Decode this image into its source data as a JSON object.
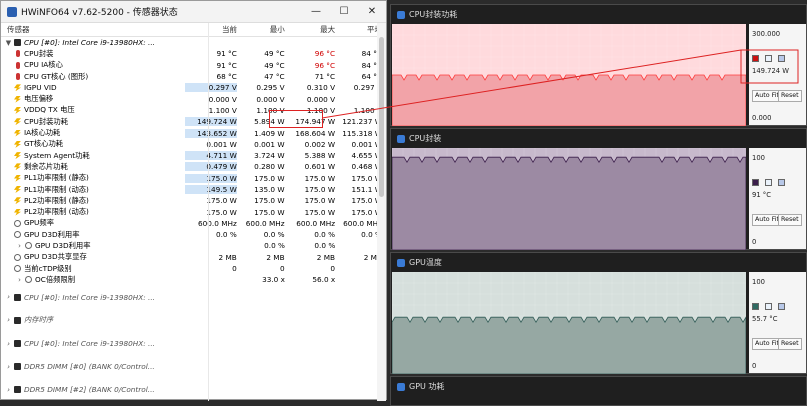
{
  "window": {
    "title": "HWiNFO64 v7.62-5200 - 传感器状态",
    "min": "—",
    "max": "☐",
    "close": "✕"
  },
  "header": {
    "sensor": "传感器",
    "current": "当前",
    "min": "最小",
    "max": "最大",
    "avg": "平均"
  },
  "rows": [
    {
      "tw": "▼",
      "icon": "chip",
      "label": "CPU [#0]: Intel Core i9-13980HX: ...",
      "italic": true,
      "c": [
        "",
        "",
        "",
        ""
      ]
    },
    {
      "tw": "",
      "icon": "therm",
      "label": "CPU封装",
      "c": [
        "91 °C",
        "49 °C",
        "96 °C",
        "84 °C"
      ],
      "maxred": true
    },
    {
      "tw": "",
      "icon": "therm",
      "label": "CPU IA核心",
      "c": [
        "91 °C",
        "49 °C",
        "96 °C",
        "84 °C"
      ],
      "maxred": true
    },
    {
      "tw": "",
      "icon": "therm",
      "label": "CPU GT核心 (图形)",
      "c": [
        "68 °C",
        "47 °C",
        "71 °C",
        "64 °C"
      ]
    },
    {
      "tw": "",
      "icon": "bolt",
      "label": "IGPU VID",
      "c": [
        "0.297 V",
        "0.295 V",
        "0.310 V",
        "0.297 V"
      ],
      "hl": true
    },
    {
      "tw": "",
      "icon": "bolt",
      "label": "电压偏移",
      "c": [
        "0.000 V",
        "0.000 V",
        "0.000 V",
        ""
      ]
    },
    {
      "tw": "",
      "icon": "bolt",
      "label": "VDDQ TX 电压",
      "c": [
        "1.100 V",
        "1.100 V",
        "1.100 V",
        "1.100 V"
      ]
    },
    {
      "tw": "",
      "icon": "bolt",
      "label": "CPU封装功耗",
      "c": [
        "149.724 W",
        "5.894 W",
        "174.947 W",
        "121.237 W"
      ],
      "hl": true
    },
    {
      "tw": "",
      "icon": "bolt",
      "label": "IA核心功耗",
      "c": [
        "143.652 W",
        "1.409 W",
        "168.604 W",
        "115.318 W"
      ],
      "hl": true
    },
    {
      "tw": "",
      "icon": "bolt",
      "label": "GT核心功耗",
      "c": [
        "0.001 W",
        "0.001 W",
        "0.002 W",
        "0.001 W"
      ]
    },
    {
      "tw": "",
      "icon": "bolt",
      "label": "System Agent功耗",
      "c": [
        "4.711 W",
        "3.724 W",
        "5.388 W",
        "4.655 W"
      ],
      "hl": true
    },
    {
      "tw": "",
      "icon": "bolt",
      "label": "剩余芯片功耗",
      "c": [
        "0.479 W",
        "0.280 W",
        "0.601 W",
        "0.468 W"
      ],
      "hl": true
    },
    {
      "tw": "",
      "icon": "bolt",
      "label": "PL1功率限制 (静态)",
      "c": [
        "175.0 W",
        "175.0 W",
        "175.0 W",
        "175.0 W"
      ],
      "hl": true
    },
    {
      "tw": "",
      "icon": "bolt",
      "label": "PL1功率限制 (动态)",
      "c": [
        "149.5 W",
        "135.0 W",
        "175.0 W",
        "151.1 W"
      ],
      "hl": true
    },
    {
      "tw": "",
      "icon": "bolt",
      "label": "PL2功率限制 (静态)",
      "c": [
        "175.0 W",
        "175.0 W",
        "175.0 W",
        "175.0 W"
      ]
    },
    {
      "tw": "",
      "icon": "bolt",
      "label": "PL2功率限制 (动态)",
      "c": [
        "175.0 W",
        "175.0 W",
        "175.0 W",
        "175.0 W"
      ]
    },
    {
      "tw": "",
      "icon": "circle",
      "label": "GPU频率",
      "c": [
        "600.0 MHz",
        "600.0 MHz",
        "600.0 MHz",
        "600.0 MHz"
      ]
    },
    {
      "tw": "",
      "icon": "circle",
      "label": "GPU D3D利用率",
      "c": [
        "0.0 %",
        "0.0 %",
        "0.0 %",
        "0.0 %"
      ]
    },
    {
      "tw": "›",
      "icon": "circle",
      "label": "GPU D3D利用率",
      "c": [
        "",
        "0.0 %",
        "0.0 %",
        ""
      ],
      "indent": true
    },
    {
      "tw": "",
      "icon": "circle",
      "label": "GPU D3D共享显存",
      "c": [
        "2 MB",
        "2 MB",
        "2 MB",
        "2 MB"
      ]
    },
    {
      "tw": "",
      "icon": "circle",
      "label": "当前cTDP级别",
      "c": [
        "0",
        "0",
        "0",
        "0"
      ]
    },
    {
      "tw": "›",
      "icon": "circle",
      "label": "OC倍频限制",
      "c": [
        "",
        "33.0 x",
        "56.0 x",
        ""
      ],
      "indent": true
    }
  ],
  "groups": [
    {
      "label": "CPU [#0]: Intel Core i9-13980HX: ..."
    },
    {
      "label": "内存时序"
    },
    {
      "label": "CPU [#0]: Intel Core i9-13980HX: ..."
    },
    {
      "label": "DDR5 DIMM [#0] (BANK 0/Control..."
    },
    {
      "label": "DDR5 DIMM [#2] (BANK 0/Control..."
    }
  ],
  "graphs": [
    {
      "title": "CPU封装功耗",
      "ymax": "300.000",
      "ymin": "0.000",
      "value": "149.724 W",
      "fill": "#f2a3a8",
      "line": "#ff3b3b",
      "bg": "#ffdadd",
      "swatch": "#cc1111",
      "level": 0.5,
      "buttons": [
        "Auto Fit",
        "Reset"
      ]
    },
    {
      "title": "CPU封装",
      "ymax": "100",
      "ymin": "0",
      "value": "91 °C",
      "fill": "#9c8aa3",
      "line": "#3a1d4a",
      "bg": "#c7b9cc",
      "swatch": "#3a1d4a",
      "level": 0.91,
      "buttons": [
        "Auto Fit",
        "Reset"
      ]
    },
    {
      "title": "GPU温度",
      "ymax": "100",
      "ymin": "0",
      "value": "55.7 °C",
      "fill": "#96a8a3",
      "line": "#2f5a55",
      "bg": "#d6dfdc",
      "swatch": "#2f6a62",
      "level": 0.557,
      "buttons": [
        "Auto Fit",
        "Reset"
      ]
    },
    {
      "title": "GPU 功耗",
      "ymax": "",
      "ymin": "",
      "value": "",
      "fill": "#aaa",
      "line": "#555",
      "bg": "#ddd",
      "swatch": "#888",
      "level": 0,
      "buttons": []
    }
  ]
}
